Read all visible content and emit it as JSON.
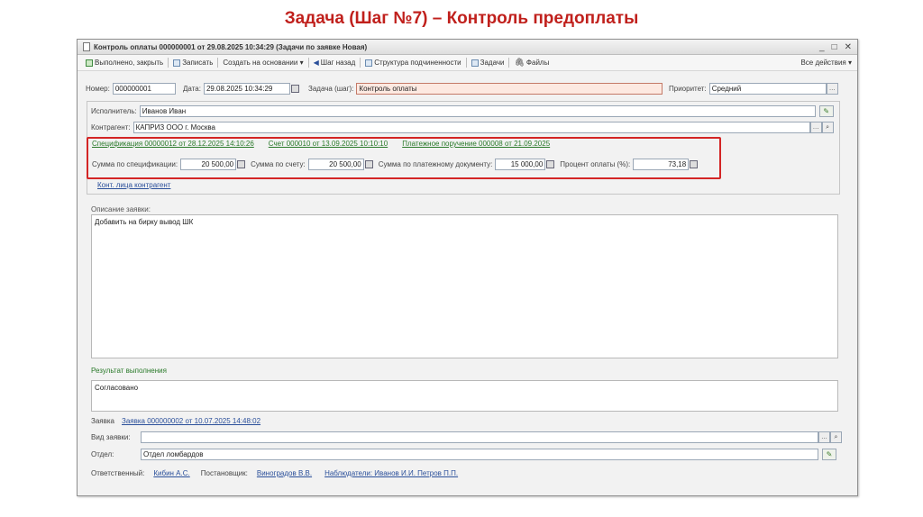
{
  "slide": {
    "title": "Задача (Шаг №7) – Контроль предоплаты"
  },
  "window": {
    "title": "Контроль оплаты 000000001 от 29.08.2025 10:34:29 (Задачи по заявке Новая)",
    "controls": [
      "_",
      "□",
      "✕"
    ]
  },
  "toolbar": {
    "done_close": "Выполнено, закрыть",
    "save": "Записать",
    "create_based": "Создать на основании ▾",
    "step_back": "Шаг назад",
    "structure": "Структура подчиненности",
    "tasks": "Задачи",
    "files": "Файлы",
    "all_actions": "Все действия ▾"
  },
  "header": {
    "number_label": "Номер:",
    "number_value": "000000001",
    "date_label": "Дата:",
    "date_value": "29.08.2025 10:34:29",
    "task_label": "Задача (шаг):",
    "task_value": "Контроль оплаты",
    "priority_label": "Приоритет:",
    "priority_value": "Средний"
  },
  "executor": {
    "label": "Исполнитель:",
    "value": "Иванов Иван"
  },
  "contractor": {
    "label": "Контрагент:",
    "value": "КАПРИЗ ООО г. Москва"
  },
  "docs": {
    "spec_link": "Спецификация 00000012 от 28.12.2025 14:10:26",
    "invoice_link": "Счет 000010 от 13.09.2025 10:10:10",
    "payment_link": "Платежное поручение 000008 от 21.09.2025"
  },
  "sums": {
    "spec_label": "Сумма по спецификации:",
    "spec_value": "20 500,00",
    "invoice_label": "Сумма по счету:",
    "invoice_value": "20 500,00",
    "payment_label": "Сумма по платежному документу:",
    "payment_value": "15 000,00",
    "percent_label": "Процент оплаты (%):",
    "percent_value": "73,18"
  },
  "contact_link": "Конт. лица контрагент",
  "description": {
    "label": "Описание заявки:",
    "text": "Добавить на бирку вывод ШК"
  },
  "result": {
    "label": "Результат выполнения",
    "text": "Согласовано"
  },
  "request": {
    "label": "Заявка",
    "link": "Заявка 000000002 от 10.07.2025 14:48:02"
  },
  "request_type": {
    "label": "Вид заявки:",
    "value": ""
  },
  "department": {
    "label": "Отдел:",
    "value": "Отдел ломбардов"
  },
  "footer": {
    "responsible_label": "Ответственный:",
    "responsible_value": "Кибин А.С.",
    "setter_label": "Постановщик:",
    "setter_value": "Виноградов В.В.",
    "observers_link": "Наблюдатели: Иванов И.И. Петров П.П."
  }
}
